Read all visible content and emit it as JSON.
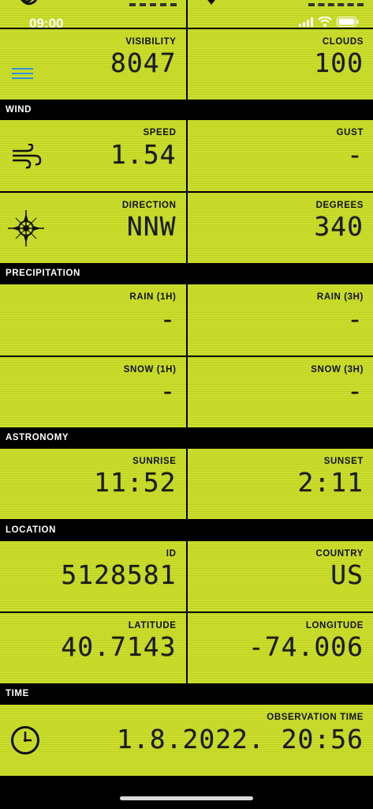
{
  "status_bar": {
    "time": "09:00"
  },
  "rows": {
    "visibility": {
      "label": "VISIBILITY",
      "value": "8047"
    },
    "clouds": {
      "label": "CLOUDS",
      "value": "100"
    }
  },
  "sections": {
    "wind": "WIND",
    "precipitation": "PRECIPITATION",
    "astronomy": "ASTRONOMY",
    "location": "LOCATION",
    "time": "TIME"
  },
  "wind": {
    "speed": {
      "label": "SPEED",
      "value": "1.54"
    },
    "gust": {
      "label": "GUST",
      "value": "-"
    },
    "direction": {
      "label": "DIRECTION",
      "value": "NNW"
    },
    "degrees": {
      "label": "DEGREES",
      "value": "340"
    }
  },
  "precipitation": {
    "rain_1h": {
      "label": "RAIN (1H)",
      "value": "-"
    },
    "rain_3h": {
      "label": "RAIN (3H)",
      "value": "-"
    },
    "snow_1h": {
      "label": "SNOW (1H)",
      "value": "-"
    },
    "snow_3h": {
      "label": "SNOW (3H)",
      "value": "-"
    }
  },
  "astronomy": {
    "sunrise": {
      "label": "SUNRISE",
      "value": "11:52"
    },
    "sunset": {
      "label": "SUNSET",
      "value": "2:11"
    }
  },
  "location": {
    "id": {
      "label": "ID",
      "value": "5128581"
    },
    "country": {
      "label": "COUNTRY",
      "value": "US"
    },
    "latitude": {
      "label": "LATITUDE",
      "value": "40.7143"
    },
    "longitude": {
      "label": "LONGITUDE",
      "value": "-74.006"
    }
  },
  "time": {
    "observation": {
      "label": "OBSERVATION TIME",
      "value": "1.8.2022. 20:56"
    }
  },
  "colors": {
    "lcd": "#cadd2a",
    "menu_icon": "#2e8fe0",
    "background": "#000000"
  },
  "icons": [
    "hamburger-menu-icon",
    "wind-icon",
    "compass-icon",
    "clock-icon",
    "wifi-icon",
    "battery-icon",
    "signal-icon"
  ]
}
